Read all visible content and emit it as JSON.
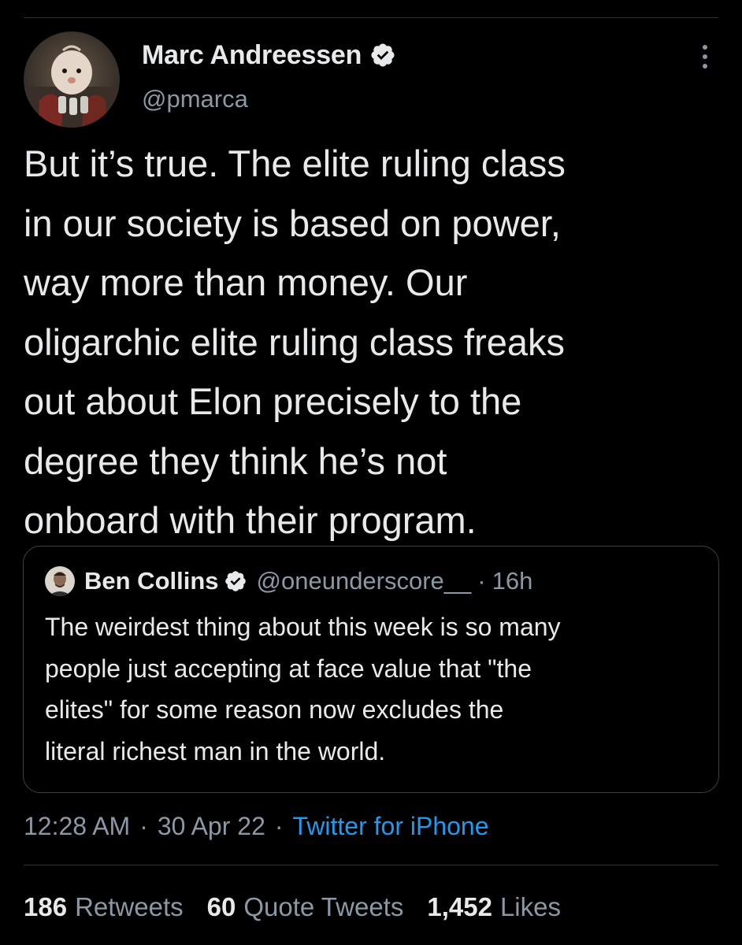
{
  "tweet": {
    "author": {
      "name": "Marc Andreessen",
      "handle": "@pmarca",
      "verified": true
    },
    "text": "But it’s true. The elite ruling class\nin our society is based on power,\nway more than money. Our\noligarchic elite ruling class freaks\nout about Elon precisely to the\ndegree they think he’s not\nonboard with their program.",
    "quoted": {
      "name": "Ben Collins",
      "handle": "@oneunderscore__",
      "separator": "·",
      "time": "16h",
      "verified": true,
      "text": "The weirdest thing about this week is so many\npeople just accepting at face value that \"the\nelites\" for some reason now excludes the\nliteral richest man in the world."
    },
    "meta": {
      "time": "12:28 AM",
      "separator": "·",
      "date": "30 Apr 22",
      "source": "Twitter for iPhone"
    },
    "stats": {
      "retweets_count": "186",
      "retweets_label": "Retweets",
      "quotes_count": "60",
      "quotes_label": "Quote Tweets",
      "likes_count": "1,452",
      "likes_label": "Likes"
    }
  },
  "icons": {
    "verified": "verified-badge-icon",
    "more": "more-vertical-icon"
  },
  "colors": {
    "background": "#000000",
    "text_primary": "#e7e9ea",
    "text_secondary": "#8b98a5",
    "link": "#1d9bf0",
    "divider": "#2f3336"
  }
}
